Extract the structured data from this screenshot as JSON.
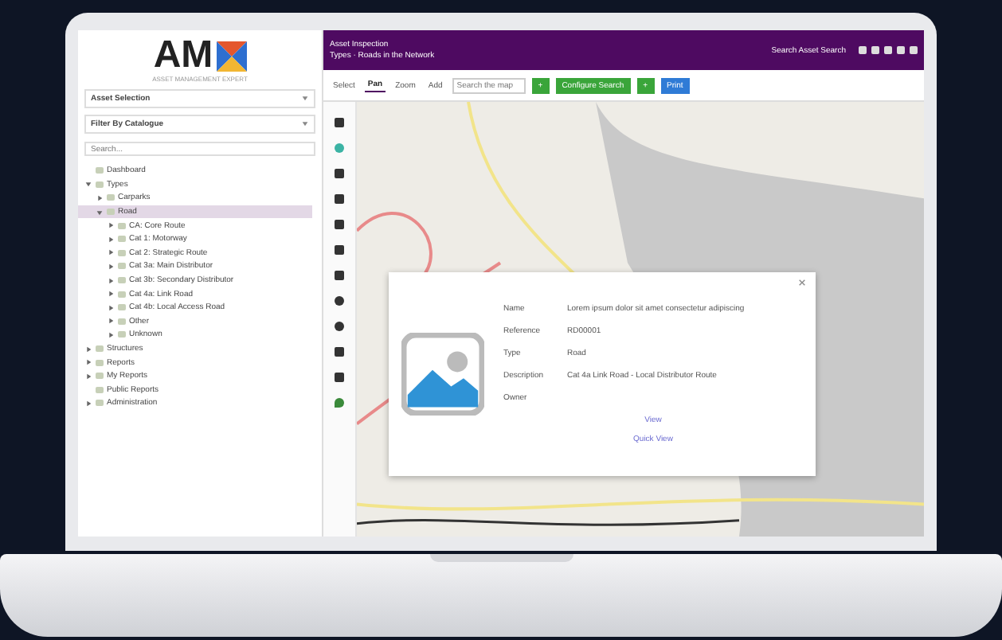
{
  "logo": {
    "text": "AM",
    "tagline": "ASSET MANAGEMENT EXPERT"
  },
  "sidebar": {
    "dropdowns": [
      {
        "label": "Asset Selection"
      },
      {
        "label": "Filter By Catalogue"
      }
    ],
    "search": {
      "placeholder": "Search..."
    },
    "tree": [
      {
        "label": "Dashboard",
        "selected": false
      },
      {
        "label": "Types",
        "selected": false,
        "expanded": true,
        "children": [
          {
            "label": "Carparks",
            "selected": false,
            "expanded": false
          },
          {
            "label": "Road",
            "selected": true,
            "expanded": true,
            "children": [
              {
                "label": "CA: Core Route",
                "selected": false,
                "expanded": false
              },
              {
                "label": "Cat 1: Motorway",
                "selected": false,
                "expanded": false
              },
              {
                "label": "Cat 2: Strategic Route",
                "selected": false,
                "expanded": false
              },
              {
                "label": "Cat 3a: Main Distributor",
                "selected": false,
                "expanded": false
              },
              {
                "label": "Cat 3b: Secondary Distributor",
                "selected": false,
                "expanded": false
              },
              {
                "label": "Cat 4a: Link Road",
                "selected": false,
                "expanded": false
              },
              {
                "label": "Cat 4b: Local Access Road",
                "selected": false,
                "expanded": false
              },
              {
                "label": "Other",
                "selected": false,
                "expanded": false
              },
              {
                "label": "Unknown",
                "selected": false,
                "expanded": false
              }
            ]
          }
        ]
      },
      {
        "label": "Structures",
        "selected": false,
        "expanded": false
      },
      {
        "label": "Reports",
        "selected": false,
        "expanded": false
      },
      {
        "label": "My Reports",
        "selected": false,
        "expanded": false
      },
      {
        "label": "Public Reports",
        "selected": false
      },
      {
        "label": "Administration",
        "selected": false,
        "expanded": false
      }
    ]
  },
  "topbar": {
    "title": "Asset Inspection",
    "breadcrumb": "Types · Roads in the Network",
    "search_label": "Search Asset Search"
  },
  "toolbar": {
    "tools": [
      {
        "label": "Select",
        "selected": false
      },
      {
        "label": "Pan",
        "selected": true
      },
      {
        "label": "Zoom",
        "selected": false
      },
      {
        "label": "Add",
        "selected": false
      }
    ],
    "search": {
      "placeholder": "Search the map"
    },
    "buttons": [
      {
        "kind": "green",
        "label": "+"
      },
      {
        "kind": "green",
        "label": "Configure Search"
      },
      {
        "kind": "green",
        "label": "+"
      },
      {
        "kind": "blue",
        "label": "Print"
      }
    ]
  },
  "popup": {
    "fields": [
      {
        "label": "Name",
        "value": "Lorem ipsum dolor sit amet consectetur adipiscing"
      },
      {
        "label": "Reference",
        "value": "RD00001"
      },
      {
        "label": "Type",
        "value": "Road"
      },
      {
        "label": "Description",
        "value": "Cat 4a Link Road - Local Distributor Route"
      },
      {
        "label": "Owner"
      }
    ],
    "links": [
      "View",
      "Quick View"
    ]
  }
}
